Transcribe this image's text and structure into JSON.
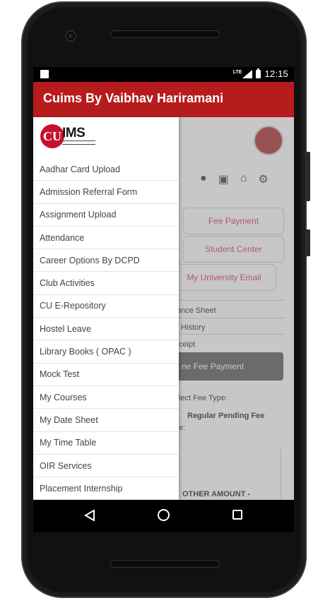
{
  "status_bar": {
    "time": "12:15",
    "network": "LTE"
  },
  "app_bar": {
    "title": "Cuims By Vaibhav Hariramani"
  },
  "drawer": {
    "logo": {
      "badge": "CU",
      "text": "IMS"
    },
    "items": [
      {
        "label": "Aadhar Card Upload"
      },
      {
        "label": "Admission Referral Form"
      },
      {
        "label": "Assignment Upload"
      },
      {
        "label": "Attendance"
      },
      {
        "label": "Career Options By DCPD"
      },
      {
        "label": "Club Activities"
      },
      {
        "label": "CU E-Repository"
      },
      {
        "label": "Hostel Leave"
      },
      {
        "label": "Library Books ( OPAC )"
      },
      {
        "label": "Mock Test"
      },
      {
        "label": "My Courses"
      },
      {
        "label": "My Date Sheet"
      },
      {
        "label": "My Time Table"
      },
      {
        "label": "OIR Services"
      },
      {
        "label": "Placement Internship"
      }
    ]
  },
  "background": {
    "fee_payment": "Fee Payment",
    "student_center": "Student Center",
    "university_email": "My University Email",
    "finance_sheet": "ance Sheet",
    "history": "t History",
    "receipt": "ceipt",
    "online_fee_payment": "ne Fee Payment",
    "select_fee_type": "lect Fee Type:",
    "regular_pending_fee": "Regular Pending Fee",
    "colon_e": "e:",
    "other_amount": "OTHER AMOUNT -"
  },
  "colors": {
    "app_bar": "#b71c1c",
    "status_bar": "#000000",
    "drawer_bg": "#ffffff"
  }
}
